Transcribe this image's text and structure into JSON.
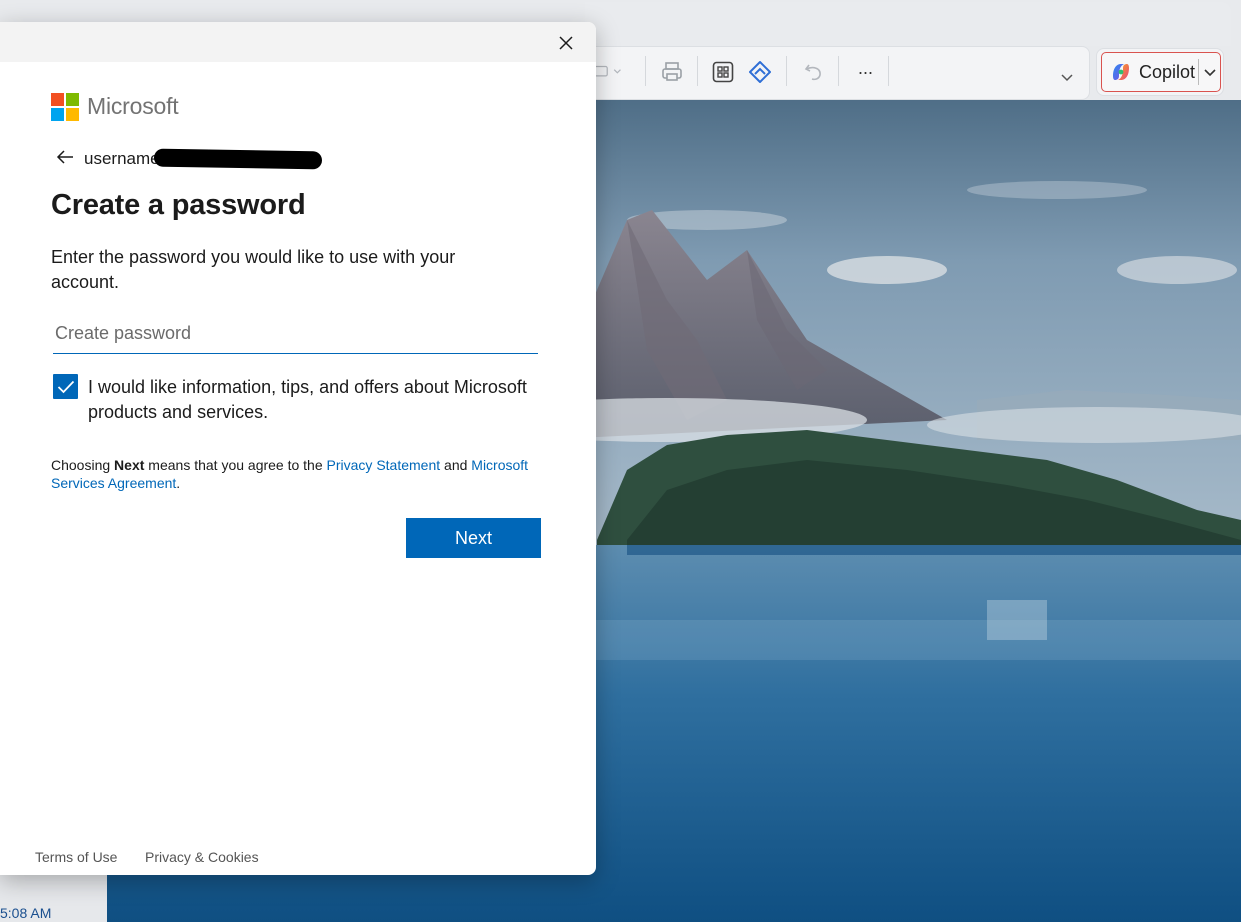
{
  "background": {
    "toolbar": {
      "icons": [
        "print-icon",
        "grid-icon",
        "shape-icon",
        "undo-icon",
        "more-icon"
      ],
      "more_glyph": "···"
    },
    "copilot_label": "Copilot",
    "clock": "5:08 AM"
  },
  "dialog": {
    "brand": "Microsoft",
    "email_visible": "username",
    "title": "Create a password",
    "description": "Enter the password you would like to use with your account.",
    "password_placeholder": "Create password",
    "password_value": "",
    "marketing_optin_checked": true,
    "marketing_optin_label": "I would like information, tips, and offers about Microsoft products and services.",
    "legal": {
      "prefix": "Choosing ",
      "bold": "Next",
      "middle": " means that you agree to the ",
      "privacy_link": "Privacy Statement",
      "and": " and ",
      "msa_link": "Microsoft Services Agreement",
      "suffix": "."
    },
    "next_label": "Next",
    "footer": {
      "terms": "Terms of Use",
      "privacy": "Privacy & Cookies"
    }
  },
  "colors": {
    "accent": "#0067b8",
    "logo_red": "#f25022",
    "logo_green": "#7fba00",
    "logo_blue": "#00a4ef",
    "logo_yellow": "#ffb900"
  }
}
